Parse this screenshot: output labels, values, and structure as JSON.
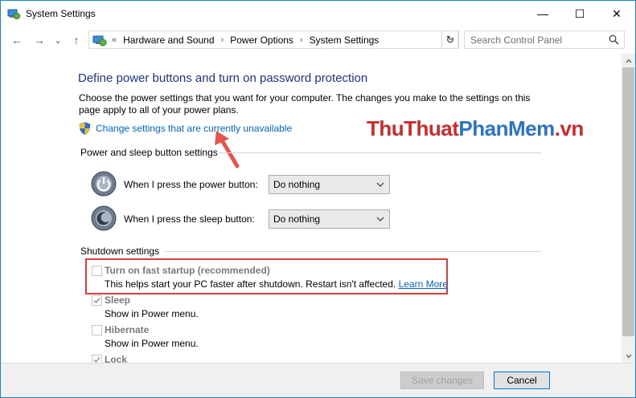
{
  "window": {
    "title": "System Settings",
    "minimize": "—",
    "maximize": "☐",
    "close": "✕"
  },
  "nav": {
    "back": "←",
    "forward": "→",
    "recent": "⌄",
    "up": "↑",
    "breadcrumb_prefix": "«",
    "breadcrumbs": [
      "Hardware and Sound",
      "Power Options",
      "System Settings"
    ],
    "separator": "›",
    "address_dropdown": "⌄",
    "refresh": "↻",
    "search_placeholder": "Search Control Panel"
  },
  "content": {
    "heading": "Define power buttons and turn on password protection",
    "description": "Choose the power settings that you want for your computer. The changes you make to the settings on this page apply to all of your power plans.",
    "change_link": "Change settings that are currently unavailable",
    "watermark": {
      "part1": "ThuThuat",
      "part2": "PhanMem",
      "part3": ".vn"
    },
    "power_group": {
      "label": "Power and sleep button settings",
      "power_button_label": "When I press the power button:",
      "power_button_value": "Do nothing",
      "sleep_button_label": "When I press the sleep button:",
      "sleep_button_value": "Do nothing"
    },
    "shutdown_group": {
      "label": "Shutdown settings",
      "items": [
        {
          "label": "Turn on fast startup (recommended)",
          "desc": "This helps start your PC faster after shutdown. Restart isn't affected.",
          "link": "Learn More",
          "checked": false
        },
        {
          "label": "Sleep",
          "desc": "Show in Power menu.",
          "checked": true
        },
        {
          "label": "Hibernate",
          "desc": "Show in Power menu.",
          "checked": false
        },
        {
          "label": "Lock",
          "checked": true
        }
      ]
    }
  },
  "footer": {
    "save": "Save changes",
    "cancel": "Cancel"
  },
  "colors": {
    "heading": "#1e3287",
    "link": "#0066cc",
    "highlight": "#e23b3b",
    "arrow": "#e8534a"
  }
}
